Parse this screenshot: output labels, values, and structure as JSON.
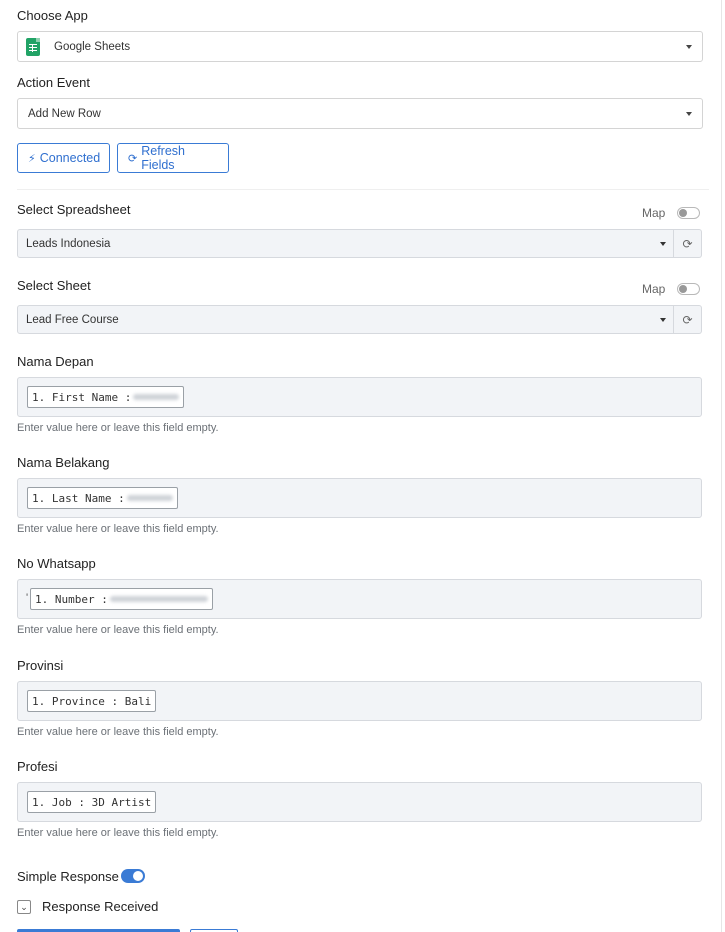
{
  "choose_app": {
    "label": "Choose App",
    "value": "Google Sheets",
    "icon": "google-sheets-icon"
  },
  "action_event": {
    "label": "Action Event",
    "value": "Add New Row"
  },
  "buttons": {
    "connected": "Connected",
    "refresh_fields": "Refresh Fields"
  },
  "spreadsheet": {
    "label": "Select Spreadsheet",
    "map_label": "Map",
    "value": "Leads Indonesia"
  },
  "sheet": {
    "label": "Select Sheet",
    "map_label": "Map",
    "value": "Lead Free Course"
  },
  "fields": [
    {
      "label": "Nama Depan",
      "tag": "1. First Name :",
      "hint": "Enter value here or leave this field empty."
    },
    {
      "label": "Nama Belakang",
      "tag": "1. Last Name :",
      "hint": "Enter value here or leave this field empty."
    },
    {
      "label": "No Whatsapp",
      "prefix": "'",
      "tag": "1. Number :",
      "hint": "Enter value here or leave this field empty."
    },
    {
      "label": "Provinsi",
      "tag": "1. Province : Bali",
      "hint": "Enter value here or leave this field empty."
    },
    {
      "label": "Profesi",
      "tag": "1. Job : 3D Artist",
      "hint": "Enter value here or leave this field empty."
    }
  ],
  "simple_response": {
    "label": "Simple Response",
    "enabled": true
  },
  "response_received": {
    "label": "Response Received"
  },
  "colors": {
    "accent": "#3a7bd5",
    "sheets_green": "#21a366"
  }
}
